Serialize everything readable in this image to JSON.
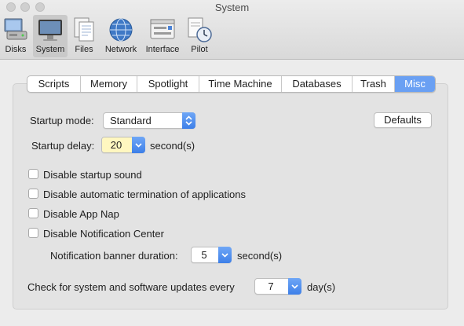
{
  "window": {
    "title": "System"
  },
  "toolbar": {
    "items": [
      {
        "label": "Disks",
        "icon": "disks-icon"
      },
      {
        "label": "System",
        "icon": "system-monitor-icon",
        "selected": true
      },
      {
        "label": "Files",
        "icon": "files-icon"
      },
      {
        "label": "Network",
        "icon": "network-globe-icon"
      },
      {
        "label": "Interface",
        "icon": "interface-window-icon"
      },
      {
        "label": "Pilot",
        "icon": "pilot-clock-icon"
      }
    ]
  },
  "tabs": [
    "Scripts",
    "Memory",
    "Spotlight",
    "Time Machine",
    "Databases",
    "Trash",
    "Misc"
  ],
  "active_tab": "Misc",
  "misc": {
    "startup_mode_label": "Startup mode:",
    "startup_mode_value": "Standard",
    "defaults_label": "Defaults",
    "startup_delay_label": "Startup delay:",
    "startup_delay_value": "20",
    "startup_delay_unit": "second(s)",
    "checkboxes": [
      {
        "label": "Disable startup sound",
        "checked": false
      },
      {
        "label": "Disable automatic termination of applications",
        "checked": false
      },
      {
        "label": "Disable App Nap",
        "checked": false
      },
      {
        "label": "Disable Notification Center",
        "checked": false
      }
    ],
    "banner_label": "Notification banner duration:",
    "banner_value": "5",
    "banner_unit": "second(s)",
    "updates_label": "Check for system and software updates every",
    "updates_value": "7",
    "updates_unit": "day(s)"
  },
  "colors": {
    "accent": "#3d7fe8",
    "selected_tab": "#6aa0f3",
    "field_highlight": "#fff7c0"
  }
}
